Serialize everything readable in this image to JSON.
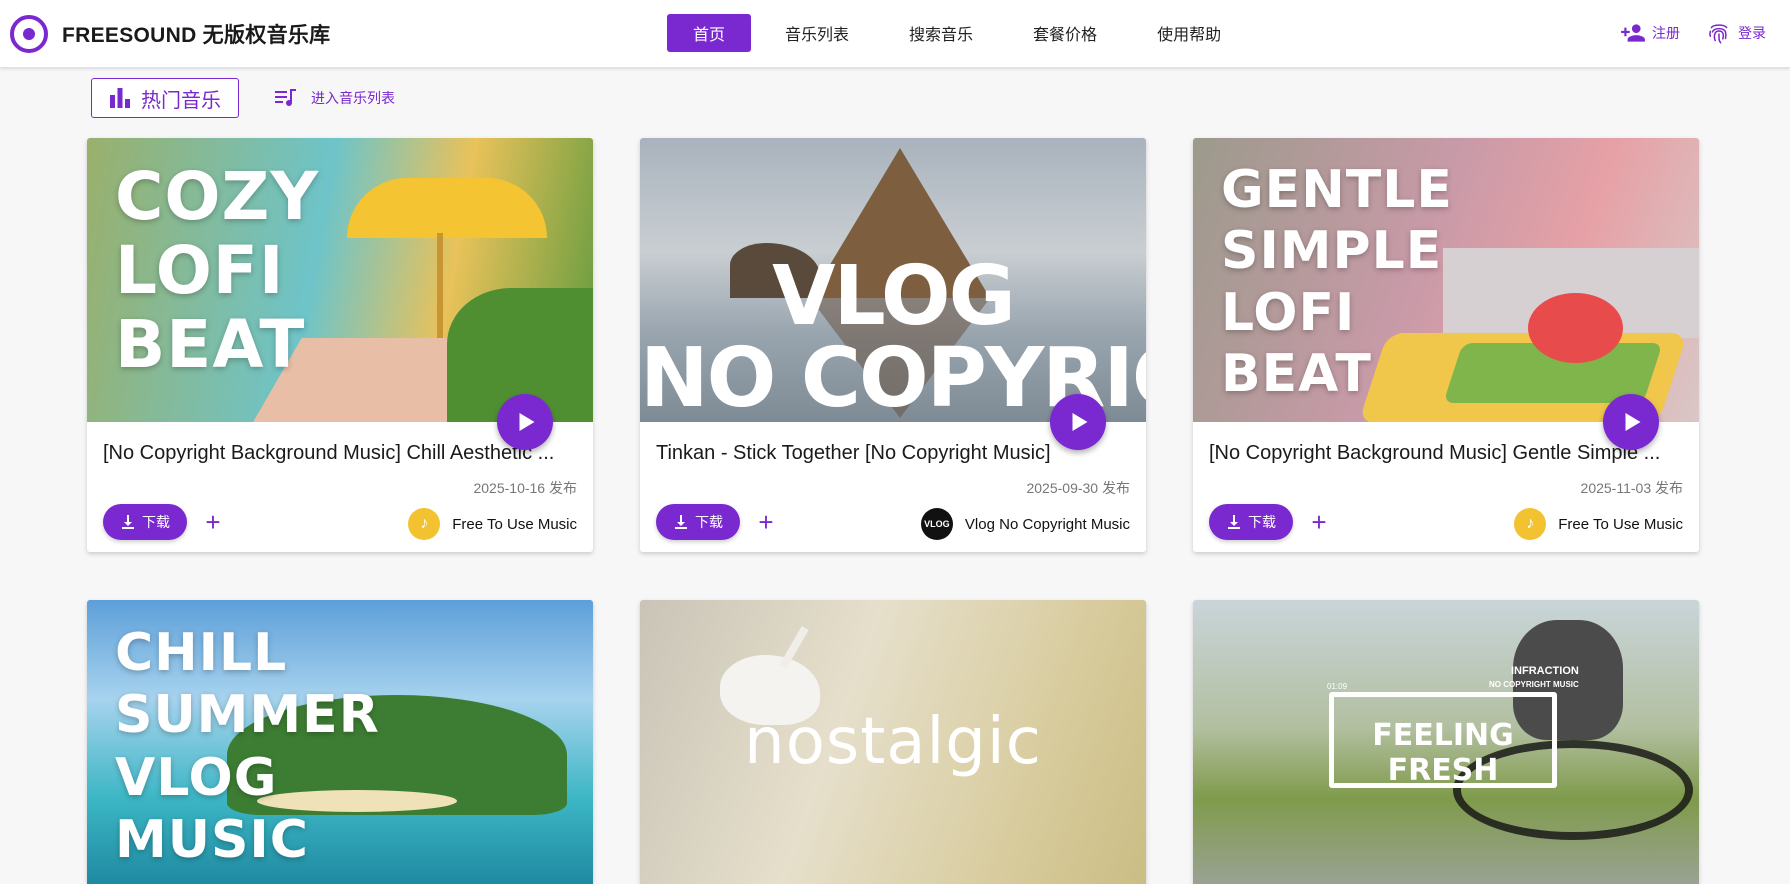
{
  "brand": {
    "name": "FREESOUND 无版权音乐库"
  },
  "nav": {
    "items": [
      {
        "label": "首页",
        "active": true
      },
      {
        "label": "音乐列表",
        "active": false
      },
      {
        "label": "搜索音乐",
        "active": false
      },
      {
        "label": "套餐价格",
        "active": false
      },
      {
        "label": "使用帮助",
        "active": false
      }
    ]
  },
  "auth": {
    "register": "注册",
    "login": "登录"
  },
  "subbar": {
    "hot_tab": "热门音乐",
    "list_link": "进入音乐列表"
  },
  "accent_color": "#7a28cf",
  "cards": [
    {
      "title": "[No Copyright Background Music] Chill Aesthetic ...",
      "date": "2025-10-16 发布",
      "download": "下载",
      "author": "Free To Use Music",
      "thumb_text": "COZY\nLOFI\nBEAT"
    },
    {
      "title": "Tinkan - Stick Together [No Copyright Music]",
      "date": "2025-09-30 发布",
      "download": "下载",
      "author": "Vlog No Copyright Music",
      "thumb_text": "VLOG\nNO COPYRIGHT"
    },
    {
      "title": "[No Copyright Background Music] Gentle Simple ...",
      "date": "2025-11-03 发布",
      "download": "下载",
      "author": "Free To Use Music",
      "thumb_text": "GENTLE\nSIMPLE\nLOFI\nBEAT"
    },
    {
      "thumb_text": "CHILL\nSUMMER\nVLOG\nMUSIC"
    },
    {
      "thumb_text": "nostalgic"
    },
    {
      "thumb_text": "FEELING FRESH",
      "thumb_sub": "INFRACTION",
      "thumb_sub2": "NO COPYRIGHT MUSIC",
      "thumb_time": "01:09"
    }
  ]
}
